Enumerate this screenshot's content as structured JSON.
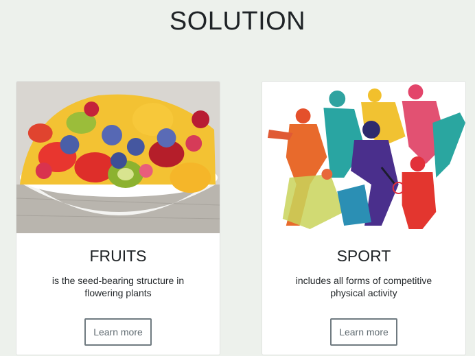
{
  "section": {
    "title": "SOLUTION"
  },
  "cards": [
    {
      "image": "fruit-salad-bowl",
      "title": "FRUITS",
      "text": "is the seed-bearing structure in flowering plants",
      "button": "Learn more"
    },
    {
      "image": "colorful-sport-silhouettes",
      "title": "SPORT",
      "text": "includes all forms of competitive physical activity",
      "button": "Learn more"
    }
  ],
  "colors": {
    "background": "#edf1ec",
    "card": "#ffffff",
    "text": "#1f2326",
    "button_border": "#6f7a80"
  }
}
